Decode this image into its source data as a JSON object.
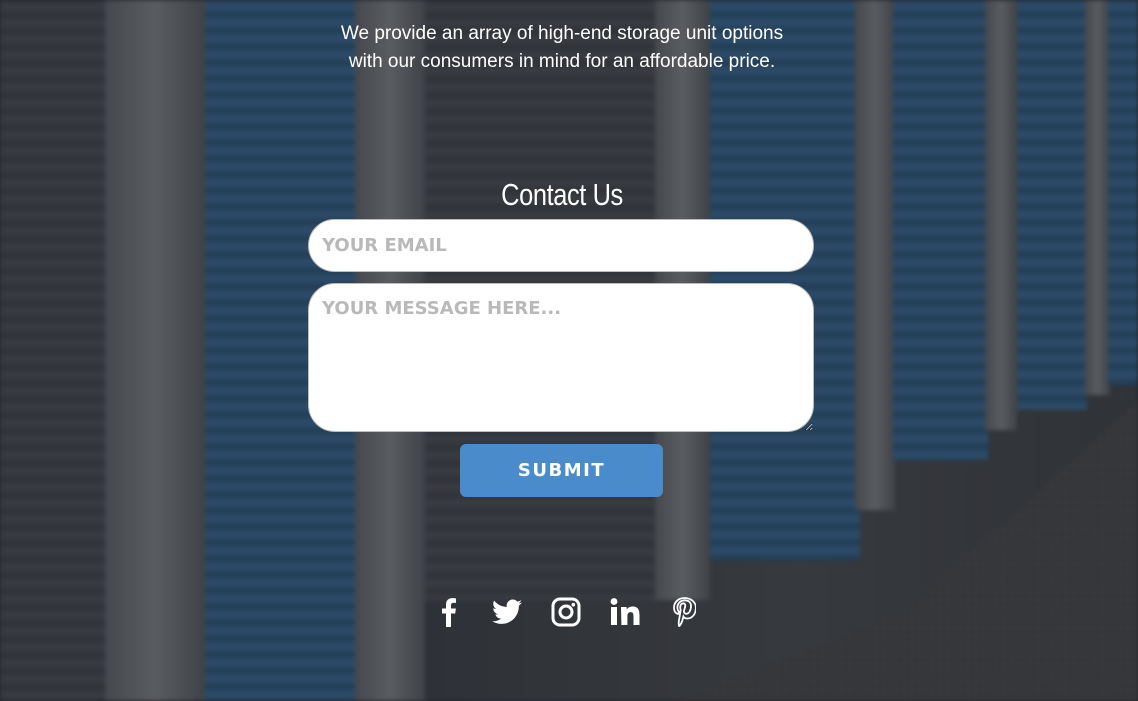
{
  "hero": {
    "tagline_line1": "We provide an array of high-end storage unit options",
    "tagline_line2": "with our consumers in mind for an affordable price."
  },
  "contact": {
    "title": "Contact Us",
    "email_placeholder": "YOUR EMAIL",
    "message_placeholder": "YOUR MESSAGE HERE...",
    "submit_label": "SUBMIT"
  },
  "social": {
    "icons": [
      "facebook-icon",
      "twitter-icon",
      "instagram-icon",
      "linkedin-icon",
      "pinterest-icon"
    ]
  },
  "colors": {
    "accent": "#4a8ccb",
    "text": "#ffffff",
    "field_border": "#bcbcbc",
    "placeholder": "#b9b9b9"
  }
}
